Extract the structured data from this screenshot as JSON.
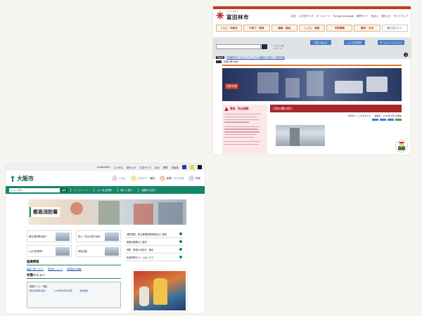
{
  "tonda": {
    "logo_text": "富田林市",
    "logo_ruby": "とん だ ばやし",
    "utils": [
      "本文",
      "Q 文字サイズ",
      "ホームページ",
      "Foreign language",
      "音声サイト",
      "色合い",
      "読み上げ",
      "サイトマップ"
    ],
    "nav": [
      "くらし・手続き",
      "子育て・教育",
      "健康・福祉",
      "しごと・産業",
      "市政情報",
      "観光・文化"
    ],
    "nav_guide": "駆け足ガイド",
    "search_radio_1": "サイト内",
    "search_radio_2": "ページ",
    "blue_buttons": [
      "お問い合わせ",
      "よくある質問",
      "ホームページについて"
    ],
    "crumb_tag": "現在地",
    "crumb_path": "富田林市ホームページトップ > 組織から探す > 消防本部",
    "crumb_current": "河南分署の紹介",
    "hero_label": "消防本部",
    "alert_title": "緊急・防災情報",
    "page_title": "河南分署の紹介",
    "meta_print": "印刷用ページを表示する",
    "meta_date": "掲載日：2016年4月1日更新"
  },
  "osaka": {
    "util": [
      "Languages",
      "ふりがな",
      "読み上げ",
      "文字サイズ",
      "拡大",
      "標準",
      "背景色"
    ],
    "brand": "大阪市",
    "nav": [
      "くらし",
      "イベント・観光",
      "産業・ビジネス",
      "市政"
    ],
    "search_placeholder": "Google 提供",
    "search_button": "検索",
    "green_links": [
      "ホームページ",
      "よくある質問",
      "使って探す",
      "組織から探す"
    ],
    "page_title": "都島消防署",
    "tiles": [
      "都島消防署の紹介",
      "防火・防災の取り組み",
      "火災予防条例",
      "緊急出動"
    ],
    "list": [
      "消防検査、防災管理者等講習会のご案内",
      "救急情報等のご案内",
      "消防・救急の手続き・届出",
      "各消防署のページはこちら"
    ],
    "section_org": "組織情報",
    "org_links": [
      "組織一覧について",
      "警防係：ページ",
      "消防救急の相談"
    ],
    "section_menu": "各種メニュー",
    "menu_header": "各種メニュー項目",
    "menu_links": [
      "都島消防署の紹介",
      "火災予防条例の周知",
      "消防組織"
    ]
  }
}
